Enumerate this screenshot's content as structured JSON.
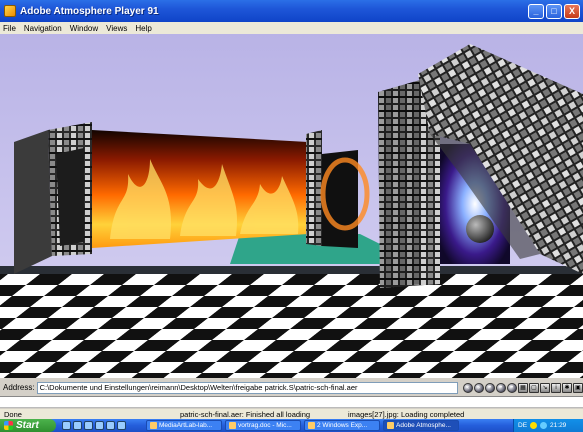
{
  "window": {
    "title": "Adobe Atmosphere Player 91",
    "buttons": {
      "minimize": "_",
      "maximize": "□",
      "close": "X"
    }
  },
  "menu": {
    "items": [
      "File",
      "Navigation",
      "Window",
      "Views",
      "Help"
    ]
  },
  "address": {
    "label": "Address:",
    "value": "C:\\Dokumente und Einstellungen\\reimann\\Desktop\\Welten\\freigabe patrick.S\\patric-sch-final.aer"
  },
  "nav_toolbar": {
    "icons": [
      "back-icon",
      "forward-icon",
      "stop-icon",
      "home-icon",
      "refresh-icon",
      "grid-icon",
      "view-icon",
      "chart-icon",
      "people-icon",
      "settings-icon",
      "extra-icon"
    ]
  },
  "status": {
    "done": "Done",
    "message1": "patric-sch-final.aer: Finished all loading",
    "message2": "images[27].jpg: Loading completed"
  },
  "taskbar": {
    "start_label": "Start",
    "tasks": [
      {
        "label": "MediaArtLab-lab..."
      },
      {
        "label": "vortrag.doc - Mic..."
      },
      {
        "label": "2 Windows Exp..."
      },
      {
        "label": "Adobe Atmosphe..."
      }
    ],
    "tray": {
      "language": "DE",
      "clock": "21:29"
    }
  },
  "colors": {
    "titlebar": "#1e56d8",
    "sky": "#c6c1ec",
    "floor_white": "#ffffff",
    "floor_black": "#111111",
    "fire": "#ff7a10"
  }
}
